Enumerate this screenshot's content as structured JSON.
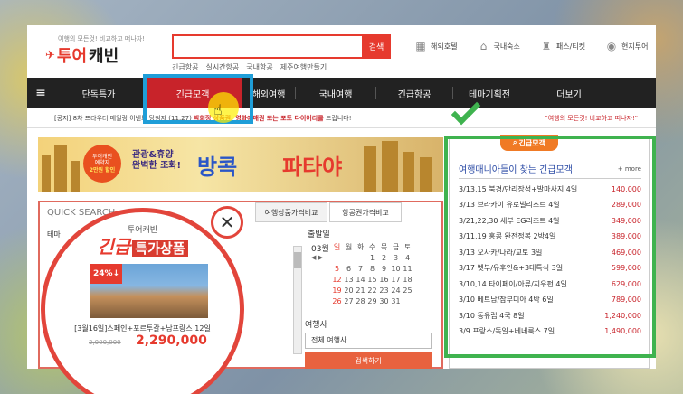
{
  "header": {
    "logo_tagline": "여행의 모든것! 비교하고 떠나자!",
    "logo_main": "투어",
    "logo_main2": "캐빈",
    "search_button": "검색",
    "search_links": [
      "긴급항공",
      "실시간항공",
      "국내항공",
      "제주여행만들기"
    ],
    "quick_links": [
      {
        "label": "해외호텔",
        "icon": "building-icon"
      },
      {
        "label": "국내숙소",
        "icon": "bell-icon"
      },
      {
        "label": "패스/티켓",
        "icon": "ticket-icon"
      },
      {
        "label": "현지투어",
        "icon": "location-pin-icon"
      }
    ]
  },
  "nav": {
    "menu_icon": "≡",
    "items": [
      "단독특가",
      "긴급모객",
      "해외여행",
      "국내여행",
      "긴급항공",
      "테마기획전",
      "더보기"
    ]
  },
  "notice": {
    "prefix": "[공지] 8차 프라우터 메일링 이벤트 당첨자 (11.27)",
    "highlight": "박희정 상품권, 영화예매권 또는 포토 다이어리를",
    "suffix": "드립니다!",
    "right": "\"여행의 모든것! 비교하고 떠나자!\""
  },
  "banner": {
    "badge_line1": "투어캐빈",
    "badge_line2": "예약자",
    "badge_line3": "2만원 할인",
    "sub_line1": "관광&휴양",
    "sub_line2": "완벽한 조화!",
    "title1": "방콕",
    "title2": "파타야"
  },
  "quick_search": {
    "title": "QUICK SEARCH",
    "title_suffix": "검색",
    "tab1": "여행상품가격비교",
    "tab2": "항공권가격비교",
    "theme_label": "테마",
    "depart_label": "출발일",
    "month": "03월",
    "weekdays": [
      "일",
      "월",
      "화",
      "수",
      "목",
      "금",
      "토"
    ],
    "weeks": [
      [
        "",
        "",
        "",
        "1",
        "2",
        "3",
        "4"
      ],
      [
        "5",
        "6",
        "7",
        "8",
        "9",
        "10",
        "11"
      ],
      [
        "12",
        "13",
        "14",
        "15",
        "16",
        "17",
        "18"
      ],
      [
        "19",
        "20",
        "21",
        "22",
        "23",
        "24",
        "25"
      ],
      [
        "26",
        "27",
        "28",
        "29",
        "30",
        "31",
        ""
      ]
    ],
    "agency_label": "여행사",
    "agency_value": "전체 여행사",
    "search_button": "검색하기"
  },
  "popup": {
    "brand": "투어캐빈",
    "title_a": "긴급",
    "title_b": "특가상품",
    "badge": "24%↓",
    "name": "[3월16일]스페인+포르투갈+남프랑스 12일",
    "old_price": "3,000,000",
    "price": "2,290,000"
  },
  "right_panel": {
    "tab": "긴급모객",
    "header": "여행매니아들이 찾는 긴급모객",
    "more": "+ more",
    "rows": [
      {
        "text": "3/13,15 북경/만리장성+발마사지 4일",
        "price": "140,000"
      },
      {
        "text": "3/13 브라카이 유로빌리조트 4일",
        "price": "289,000"
      },
      {
        "text": "3/21,22,30 세부 EG리조트 4일",
        "price": "349,000"
      },
      {
        "text": "3/11,19 홍콩 완전정복 2박4일",
        "price": "389,000"
      },
      {
        "text": "3/13 오사카/나라/교토 3일",
        "price": "469,000"
      },
      {
        "text": "3/17 벳부/유후인&+3대특식 3일",
        "price": "599,000"
      },
      {
        "text": "3/10,14 타이페이/아류/지우펀 4일",
        "price": "629,000"
      },
      {
        "text": "3/10 베트남/참부디아 4박 6일",
        "price": "789,000"
      },
      {
        "text": "3/10 동유럽 4국 8일",
        "price": "1,240,000"
      },
      {
        "text": "3/9 프랑스/독일+베네룩스 7일",
        "price": "1,490,000"
      }
    ]
  },
  "colors": {
    "brand_red": "#e63a2e",
    "nav_bg": "#222222",
    "highlight_blue": "#1f9ed8",
    "highlight_green": "#3fb34f",
    "accent_orange": "#f07a25"
  }
}
